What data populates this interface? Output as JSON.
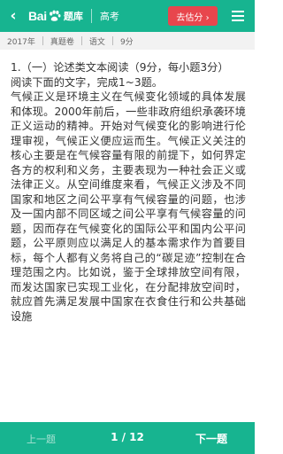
{
  "header": {
    "back_icon": "chevron-left-icon",
    "logo_brand": "Bai",
    "logo_paw_icon": "baidu-paw-icon",
    "logo_sub": "题库",
    "title": "高考",
    "estimate_button": "去估分 ›",
    "menu_icon": "hamburger-menu-icon",
    "color": "#17b490",
    "button_color": "#e8464d"
  },
  "meta": {
    "year": "2017年",
    "type": "真题卷",
    "subject": "语文",
    "score": "9分"
  },
  "question": {
    "title": "1.（一）论述类文本阅读（9分，每小题3分）",
    "instruction": "阅读下面的文字，完成1~3题。",
    "paragraph1": "气候正义是环境主义在气候变化领域的具体发展和体现。2000年前后，一些非政府组织承袭环境正义运动的精神。开始对气候变化的影响进行伦理审视，气候正义便应运而生。气候正义关注的核心主要是在气候容量有限的前提下，如何界定各方的权利和义务，主要表现为一种社会正义或法律正义。从空间维度来看，气候正义涉及不同国家和地区之间公平享有气候容量的问题，也涉及一国内部不同区域之间公平享有气候容量的问题，因而存在气候变化的国际公平和国内公平问题，公平原则应以满足人的基本需求作为首要目标，每个人都有义务将自己的“碳足迹”控制在合理范围之内。比如说，鉴于全球排放空间有限，而发达国家已实现工业化，在分配排放空间时，就应首先满足发展中国家在衣食住行和公共基础设施"
  },
  "footer": {
    "prev": "上一题",
    "page": "1 / 12",
    "next": "下一题"
  }
}
